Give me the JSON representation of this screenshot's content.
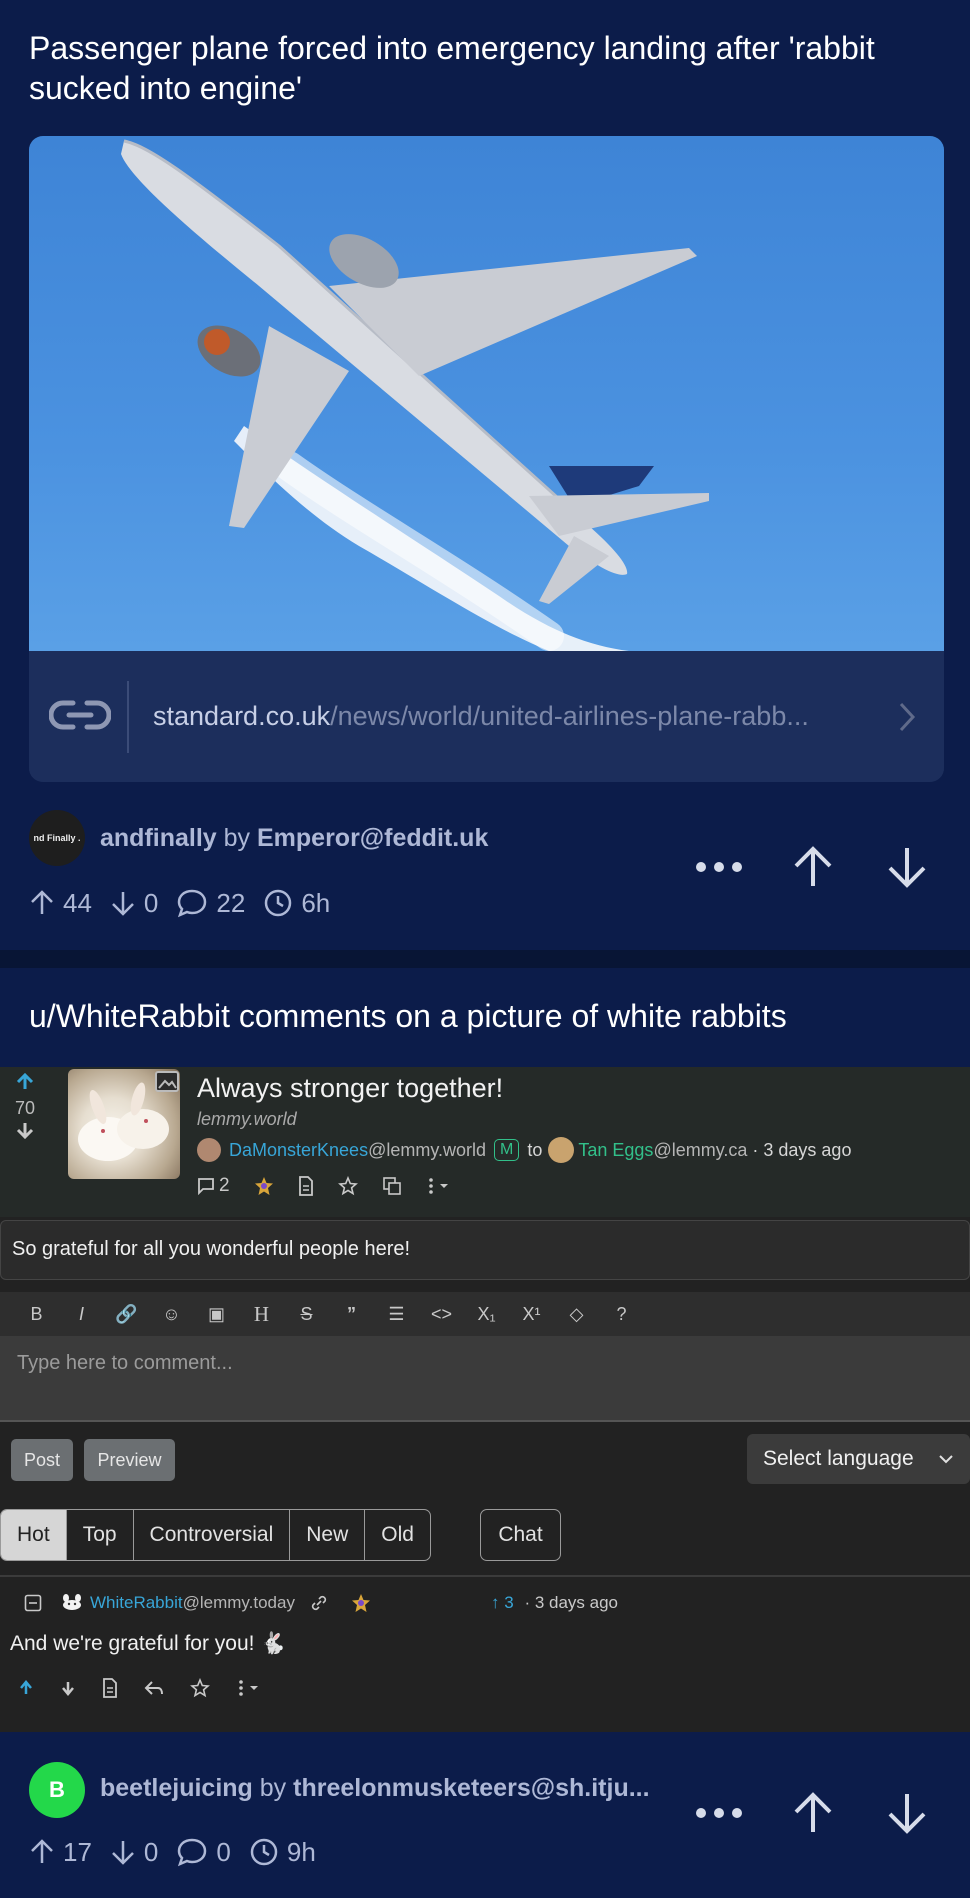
{
  "posts": [
    {
      "title": "Passenger plane forced into emergency landing after 'rabbit sucked into engine'",
      "link": {
        "domain": "standard.co.uk",
        "path": "/news/world/united-airlines-plane-rabb..."
      },
      "community_avatar_text": "nd Finally .",
      "community": "andfinally",
      "by_word": "by",
      "author": "Emperor@feddit.uk",
      "upvotes": "44",
      "downvotes": "0",
      "comments": "22",
      "age": "6h"
    },
    {
      "title": "u/WhiteRabbit comments on a picture of white rabbits"
    },
    {
      "community_avatar_text": "B",
      "community": "beetlejuicing",
      "by_word": "by",
      "author": "threelonmusketeers@sh.itju...",
      "upvotes": "17",
      "downvotes": "0",
      "comments": "0",
      "age": "9h"
    }
  ],
  "screenshot": {
    "score": "70",
    "post_title": "Always stronger together!",
    "instance": "lemmy.world",
    "poster_name": "DaMonsterKnees",
    "poster_instance": "@lemmy.world",
    "mod_badge": "M",
    "to_word": "to",
    "community_name": "Tan Eggs",
    "community_instance": "@lemmy.ca",
    "post_age": "· 3 days ago",
    "comment_count": "2",
    "body": "So grateful for all you wonderful people here!",
    "toolbar": [
      "B",
      "I",
      "🔗",
      "☺",
      "▣",
      "H",
      "S",
      "”",
      "☰",
      "<>",
      "X₁",
      "X¹",
      "◇",
      "?"
    ],
    "textarea_placeholder": "Type here to comment...",
    "post_button": "Post",
    "preview_button": "Preview",
    "select_language": "Select language",
    "sort_options": [
      "Hot",
      "Top",
      "Controversial",
      "New",
      "Old"
    ],
    "chat_button": "Chat",
    "comment": {
      "author_name": "WhiteRabbit",
      "author_instance": "@lemmy.today",
      "points": "3",
      "age": "· 3 days ago",
      "text": "And we're grateful for you! 🐇"
    }
  },
  "colors": {
    "background": "#0c1c4a",
    "screenshot_link_blue": "#38a6d8",
    "mod_green": "#32c08a",
    "avatar_b": "#23d84a"
  }
}
